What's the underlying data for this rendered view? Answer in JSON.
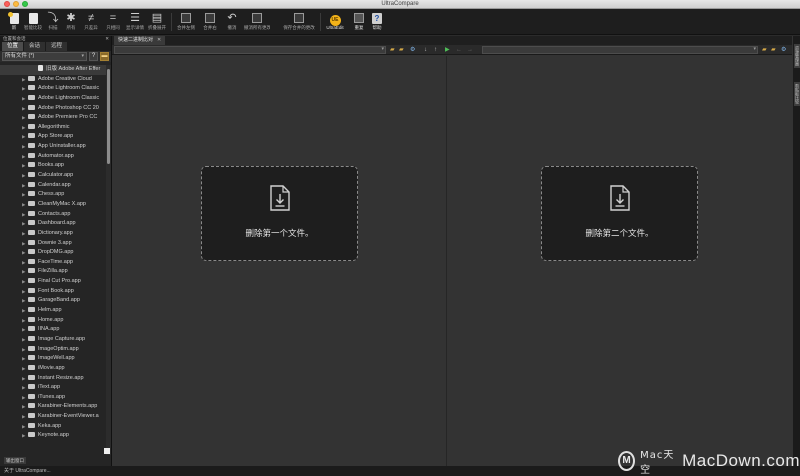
{
  "window": {
    "title": "UltraCompare"
  },
  "toolbar": {
    "buttons": [
      {
        "label": "新",
        "icon": "new-doc-icon"
      },
      {
        "label": "智能比较",
        "icon": "smart-compare-icon"
      },
      {
        "label": "扫描",
        "icon": "scan-icon"
      },
      {
        "label": "所有",
        "icon": "asterisk-icon"
      },
      {
        "label": "只差异",
        "icon": "not-equal-icon"
      },
      {
        "label": "只相同",
        "icon": "equal-icon"
      },
      {
        "label": "显示详情",
        "icon": "details-icon"
      },
      {
        "label": "折叠展开",
        "icon": "collapse-icon"
      },
      {
        "label": "合并左侧",
        "icon": "merge-left-icon"
      },
      {
        "label": "合并右",
        "icon": "merge-right-icon"
      },
      {
        "label": "撤消",
        "icon": "undo-icon"
      },
      {
        "label": "撤消所有更改",
        "icon": "undo-all-icon"
      },
      {
        "label": "保存合并的更改",
        "icon": "save-icon"
      },
      {
        "label": "UltraEdit",
        "icon": "ultraedit-icon"
      },
      {
        "label": "重复",
        "icon": "repeat-icon"
      },
      {
        "label": "帮助",
        "icon": "help-icon"
      }
    ]
  },
  "left_panel": {
    "header": "位置和会话",
    "tabs": [
      "位置",
      "会话",
      "远程"
    ],
    "filter_value": "所有文件 (*)",
    "filter_help": "?",
    "tree": [
      "旧版 Adobe After Effer",
      "Adobe Creative Cloud",
      "Adobe Lightroom Classic",
      "Adobe Lightroom Classic",
      "Adobe Photoshop CC 20",
      "Adobe Premiere Pro CC",
      "Allegorithmic",
      "App Store.app",
      "App Uninstaller.app",
      "Automator.app",
      "Books.app",
      "Calculator.app",
      "Calendar.app",
      "Chess.app",
      "CleanMyMac X.app",
      "Contacts.app",
      "Dashboard.app",
      "Dictionary.app",
      "Downie 3.app",
      "DropDMG.app",
      "FaceTime.app",
      "FileZilla.app",
      "Final Cut Pro.app",
      "Font Book.app",
      "GarageBand.app",
      "Helm.app",
      "Home.app",
      "IINA.app",
      "Image Capture.app",
      "ImageOptim.app",
      "ImageWell.app",
      "iMovie.app",
      "Instant Resize.app",
      "iText.app",
      "iTunes.app",
      "Karabiner-Elements.app",
      "Karabiner-EventViewer.a",
      "Keka.app",
      "Keynote.app"
    ],
    "footer_tab": "输出窗口"
  },
  "document": {
    "tab_label": "快速二进制比对",
    "left_drop_text": "删除第一个文件。",
    "right_drop_text": "删除第二个文件。"
  },
  "right_strip": {
    "tabs": [
      "资源管理器",
      "剪贴板比较"
    ]
  },
  "status_bar": {
    "text": "关于 UltraCompare..."
  },
  "watermark": {
    "logo": "M",
    "cn": "Mac天空",
    "en": "MacDown.com"
  },
  "colors": {
    "background": "#333333",
    "toolbar": "#1e1e1e",
    "dropzone": "#1e1e1e",
    "accent_play": "#4fbf58"
  }
}
